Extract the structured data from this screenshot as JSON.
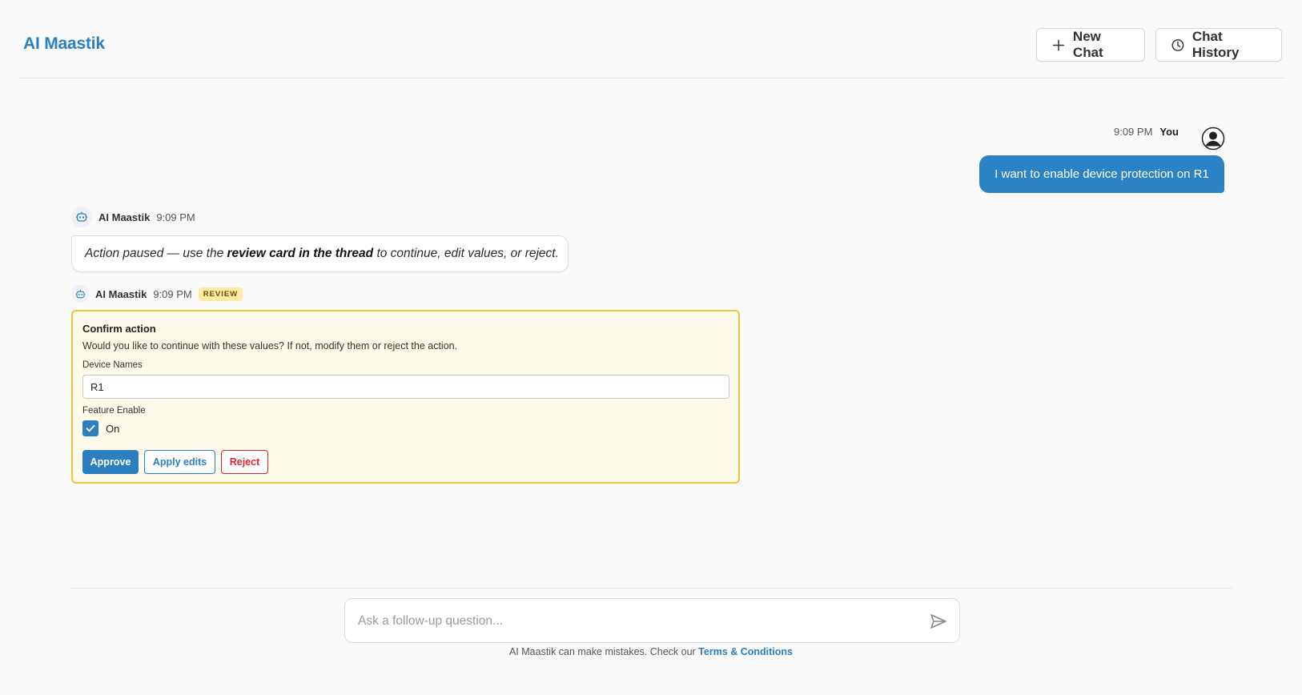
{
  "app": {
    "brand": "AI Maastik"
  },
  "header": {
    "new_chat_label": "New Chat",
    "history_label": "Chat History"
  },
  "thread": {
    "user_message": {
      "time": "9:09 PM",
      "author": "You",
      "text": "I want to enable device protection on R1"
    },
    "ai_message_1": {
      "author": "AI Maastik",
      "time": "9:09 PM",
      "text_pre": "Action paused — use the ",
      "text_bold": "review card in the thread",
      "text_post": " to continue, edit values, or reject."
    },
    "ai_message_2": {
      "author": "AI Maastik",
      "time": "9:09 PM",
      "badge": "REVIEW"
    }
  },
  "review_card": {
    "title": "Confirm action",
    "description": "Would you like to continue with these values? If not, modify them or reject the action.",
    "device_names_label": "Device Names",
    "device_names_value": "R1",
    "feature_enable_label": "Feature Enable",
    "feature_enable_checked": true,
    "feature_enable_option": "On",
    "approve_label": "Approve",
    "apply_label": "Apply edits",
    "reject_label": "Reject"
  },
  "composer": {
    "placeholder": "Ask a follow-up question..."
  },
  "footer": {
    "note_text": "AI Maastik can make mistakes. Check our ",
    "link_text": "Terms & Conditions"
  },
  "colors": {
    "accent": "#2b7fc0",
    "review_border": "#f2c335",
    "review_bg": "#fffbea",
    "danger": "#d9232e"
  }
}
